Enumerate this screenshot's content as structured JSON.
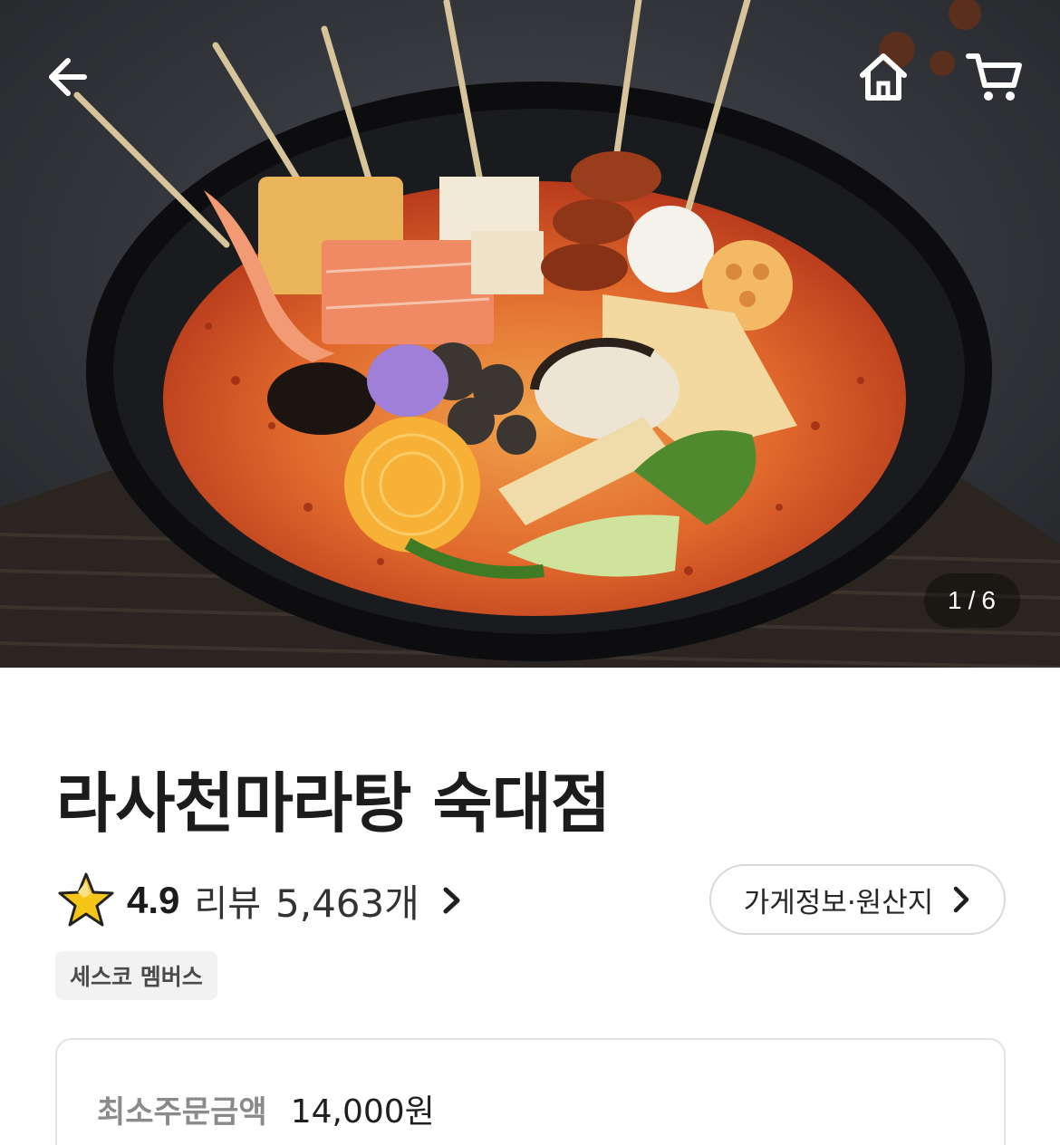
{
  "hero": {
    "image_counter": {
      "current": "1",
      "separator": "/",
      "total": "6"
    }
  },
  "nav": {
    "back_icon": "arrow-left-icon",
    "home_icon": "home-icon",
    "cart_icon": "cart-icon"
  },
  "store": {
    "name": "라사천마라탕 숙대점",
    "rating": "4.9",
    "review_label": "리뷰",
    "review_count": "5,463개",
    "info_button_label": "가게정보·원산지",
    "badge": "세스코 멤버스"
  },
  "order": {
    "min_order_label": "최소주문금액",
    "min_order_value": "14,000원"
  },
  "colors": {
    "star": "#F5C518",
    "badge_bg": "#F2F2F2",
    "border": "#D9D9D9"
  }
}
